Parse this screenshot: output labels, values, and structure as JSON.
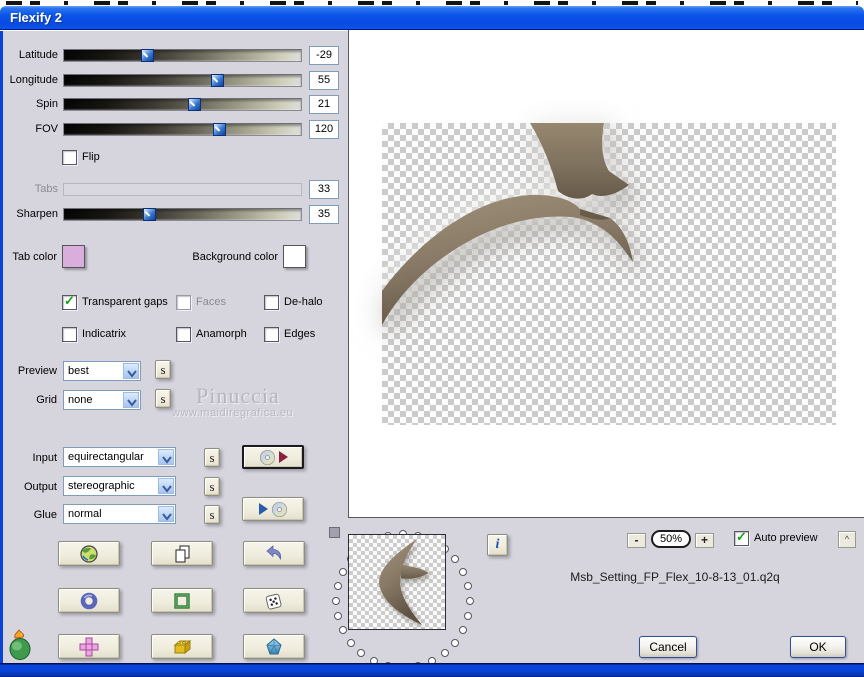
{
  "titlebar": {
    "title": "Flexify 2"
  },
  "sliders": [
    {
      "label": "Latitude",
      "value": "-29",
      "pos": 0.34,
      "disabled": false
    },
    {
      "label": "Longitude",
      "value": "55",
      "pos": 0.65,
      "disabled": false
    },
    {
      "label": "Spin",
      "value": "21",
      "pos": 0.55,
      "disabled": false
    },
    {
      "label": "FOV",
      "value": "120",
      "pos": 0.66,
      "disabled": false
    },
    {
      "label": "Tabs",
      "value": "33",
      "pos": 0,
      "disabled": true
    },
    {
      "label": "Sharpen",
      "value": "35",
      "pos": 0.35,
      "disabled": false
    }
  ],
  "flip": {
    "label": "Flip",
    "checked": false,
    "disabled": false
  },
  "colors": {
    "tab_color_label": "Tab color",
    "tab_color": "#d9aedd",
    "background_color_label": "Background color",
    "background_color": "#ffffff"
  },
  "checks": {
    "transparent_gaps": {
      "label": "Transparent gaps",
      "checked": true,
      "disabled": false
    },
    "faces": {
      "label": "Faces",
      "checked": false,
      "disabled": true
    },
    "dehalo": {
      "label": "De-halo",
      "checked": false,
      "disabled": false
    },
    "indicatrix": {
      "label": "Indicatrix",
      "checked": false,
      "disabled": false
    },
    "anamorph": {
      "label": "Anamorph",
      "checked": false,
      "disabled": false
    },
    "edges": {
      "label": "Edges",
      "checked": false,
      "disabled": false
    }
  },
  "selects": {
    "preview": {
      "label": "Preview",
      "value": "best"
    },
    "grid": {
      "label": "Grid",
      "value": "none"
    },
    "input": {
      "label": "Input",
      "value": "equirectangular"
    },
    "output": {
      "label": "Output",
      "value": "stereographic"
    },
    "glue": {
      "label": "Glue",
      "value": "normal"
    }
  },
  "s_button_label": "s",
  "watermark": {
    "name": "Pinuccia",
    "url": "www.maidiregrafica.eu"
  },
  "icon_buttons": [
    {
      "icon": "globe"
    },
    {
      "icon": "copy-pages"
    },
    {
      "icon": "undo-arrow"
    },
    {
      "icon": "torus"
    },
    {
      "icon": "green-frame"
    },
    {
      "icon": "dice"
    },
    {
      "icon": "cube-net"
    },
    {
      "icon": "lego-brick"
    },
    {
      "icon": "crystal"
    }
  ],
  "setting_buttons": {
    "save_icon": "cd-with-red-arrow",
    "load_icon": "blue-arrow-with-cd"
  },
  "logo_icon": "flaming-pear",
  "info_button": "i",
  "preview_controls": {
    "zoom_out": "-",
    "zoom_level": "50%",
    "zoom_in": "+",
    "auto_preview": {
      "label": "Auto preview",
      "checked": true,
      "disabled": false
    },
    "more_button": "^"
  },
  "filename": "Msb_Setting_FP_Flex_10-8-13_01.q2q",
  "actions": {
    "cancel": "Cancel",
    "ok": "OK"
  }
}
